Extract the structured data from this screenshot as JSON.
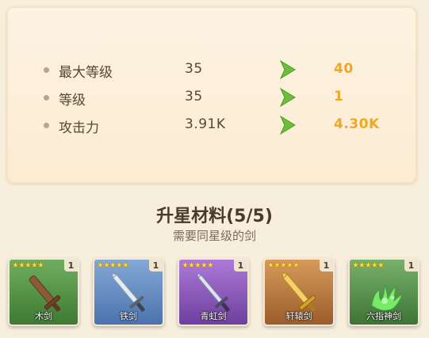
{
  "stats": [
    {
      "label": "最大等级",
      "current": "35",
      "next": "40"
    },
    {
      "label": "等级",
      "current": "35",
      "next": "1"
    },
    {
      "label": "攻击力",
      "current": "3.91K",
      "next": "4.30K"
    }
  ],
  "arrow_icon": "green-arrow-icon",
  "materials": {
    "title": "升星材料(5/5)",
    "subtitle": "需要同星级的剑",
    "items": [
      {
        "name": "木剑",
        "stars": "★★★★★",
        "count": "1",
        "rarity_color": "#4f8f42",
        "icon": "wooden-sword-icon"
      },
      {
        "name": "铁剑",
        "stars": "★★★★★",
        "count": "1",
        "rarity_color": "#5b82bd",
        "icon": "iron-sword-icon"
      },
      {
        "name": "青虹剑",
        "stars": "★★★★★",
        "count": "1",
        "rarity_color": "#7f4fb0",
        "icon": "qinghong-sword-icon"
      },
      {
        "name": "轩辕剑",
        "stars": "★★★★★",
        "count": "1",
        "rarity_color": "#b0713b",
        "icon": "xuanyuan-sword-icon"
      },
      {
        "name": "六指神剑",
        "stars": "★★★★★",
        "count": "1",
        "rarity_color": "#4f8a44",
        "icon": "six-finger-sword-icon"
      }
    ]
  }
}
